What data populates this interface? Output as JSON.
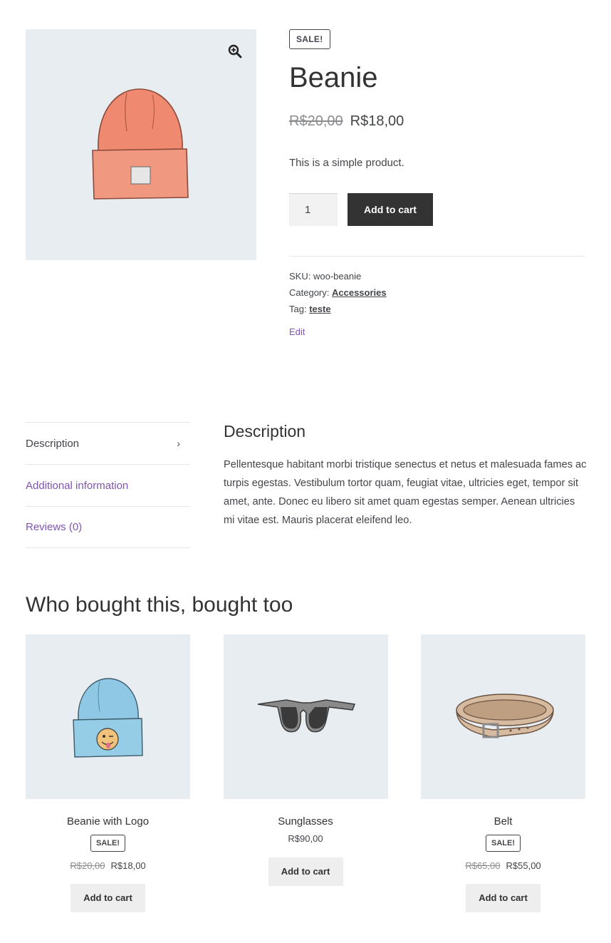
{
  "product": {
    "sale_badge": "SALE!",
    "title": "Beanie",
    "price_old": "R$20,00",
    "price_new": "R$18,00",
    "short_description": "This is a simple product.",
    "quantity": "1",
    "add_to_cart_label": "Add to cart",
    "sku_label": "SKU:",
    "sku_value": "woo-beanie",
    "category_label": "Category:",
    "category_value": "Accessories",
    "tag_label": "Tag:",
    "tag_value": "teste",
    "edit_label": "Edit",
    "image_bg": "#e8edf1"
  },
  "tabs": [
    {
      "label": "Description"
    },
    {
      "label": "Additional information"
    },
    {
      "label": "Reviews (0)"
    }
  ],
  "panel": {
    "title": "Description",
    "text": "Pellentesque habitant morbi tristique senectus et netus et malesuada fames ac turpis egestas. Vestibulum tortor quam, feugiat vitae, ultricies eget, tempor sit amet, ante. Donec eu libero sit amet quam egestas semper. Aenean ultricies mi vitae est. Mauris placerat eleifend leo."
  },
  "related": {
    "title": "Who bought this, bought too",
    "items": [
      {
        "name": "Beanie with Logo",
        "badge": "SALE!",
        "price_old": "R$20,00",
        "price_new": "R$18,00",
        "button": "Add to cart"
      },
      {
        "name": "Sunglasses",
        "price": "R$90,00",
        "button": "Add to cart"
      },
      {
        "name": "Belt",
        "badge": "SALE!",
        "price_old": "R$65,00",
        "price_new": "R$55,00",
        "button": "Add to cart"
      }
    ]
  },
  "colors": {
    "accent": "#7f54b3",
    "button_dark": "#333333",
    "button_light": "#eeeeee",
    "text": "#43454b"
  }
}
